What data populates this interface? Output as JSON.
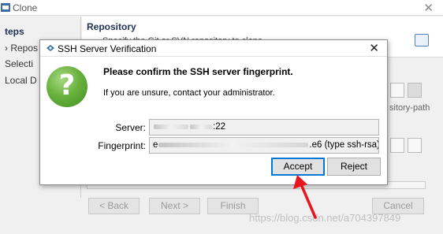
{
  "background_window": {
    "title": "Clone",
    "steps": {
      "heading": "teps",
      "items": [
        "› Repos",
        "Selecti",
        "Local D"
      ]
    },
    "header": {
      "title": "Repository",
      "description": "Specify the Git or SVN repository to clone"
    },
    "repository_path_fragment": "sitory-path",
    "buttons": {
      "back": "< Back",
      "next": "Next >",
      "finish": "Finish",
      "cancel": "Cancel"
    },
    "watermark": "https://blog.csdn.net/a704397849"
  },
  "dialog": {
    "title": "SSH Server Verification",
    "confirm_text": "Please confirm the SSH server fingerprint.",
    "contact_text": "If you are unsure, contact your administrator.",
    "question_icon": "?",
    "server": {
      "label": "Server:",
      "value_visible_suffix": ":22"
    },
    "fingerprint": {
      "label": "Fingerprint:",
      "value_prefix": "e",
      "value_suffix": ".e6 (type ssh-rsa)"
    },
    "buttons": {
      "accept": "Accept",
      "reject": "Reject"
    }
  },
  "annotation": {
    "arrow_color": "#e8141e"
  },
  "colors": {
    "default_button_border": "#0078d7",
    "question_icon_green": "#5aa530"
  }
}
